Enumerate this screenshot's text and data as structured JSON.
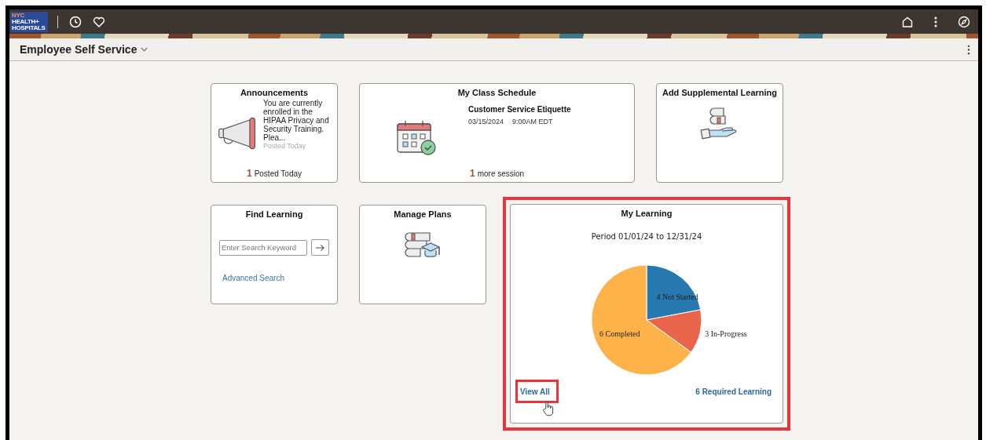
{
  "header": {
    "logo_lines": [
      "NYC",
      "HEALTH+",
      "HOSPITALS"
    ]
  },
  "title_bar": {
    "title": "Employee Self Service"
  },
  "tiles": [
    {
      "kind": "announcements",
      "title": "Announcements",
      "message": "You are currently enrolled in the HIPAA Privacy and Security Training. Plea...",
      "posted": "Posted Today",
      "count": "1",
      "footer": "Posted Today"
    },
    {
      "kind": "schedule",
      "title": "My Class Schedule",
      "course": "Customer Service Etiquette",
      "date": "03/15/2024",
      "time": "9:00AM EDT",
      "count": "1",
      "footer": "more session"
    },
    {
      "kind": "books-hand",
      "title": "Add Supplemental Learning"
    },
    {
      "kind": "search",
      "title": "Find Learning",
      "placeholder": "Enter Search Keyword",
      "link": "Advanced Search"
    },
    {
      "kind": "books-cap",
      "title": "Manage Plans"
    },
    {
      "kind": "chart",
      "title": "My Learning",
      "highlighted": true,
      "period": "Period 01/01/24 to 12/31/24",
      "link": "View All",
      "link_highlighted": true,
      "footer": "6 Required Learning",
      "chart_data": {
        "type": "pie",
        "categories": [
          "4 Not Started",
          "3 In-Progress",
          "6 Completed"
        ],
        "series": [
          {
            "values": [
              22,
              13,
              65
            ]
          }
        ],
        "colors": [
          "#2878b0",
          "#e8644a",
          "#fdb34a"
        ]
      }
    }
  ]
}
